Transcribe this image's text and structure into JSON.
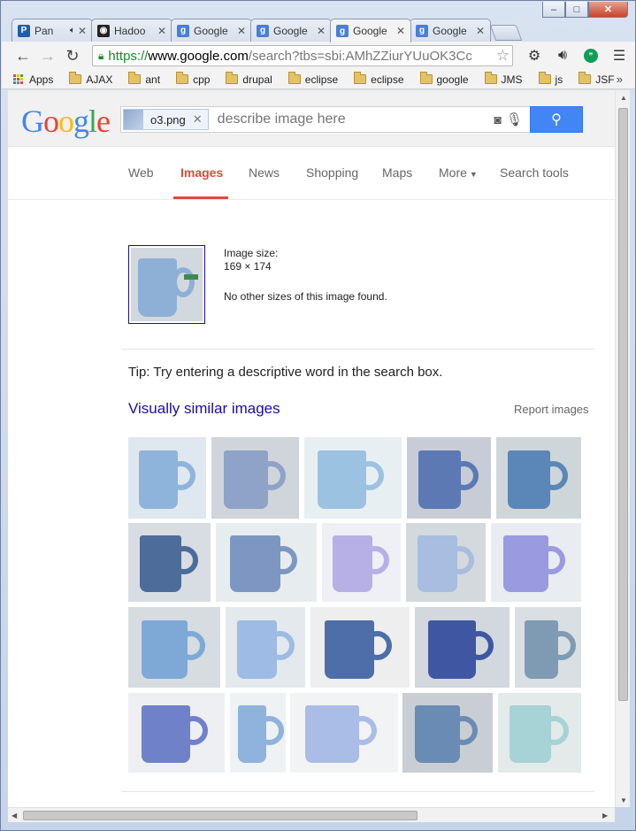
{
  "window_controls": {
    "minimize": "‒",
    "maximize": "□",
    "close": "✕"
  },
  "tabs": [
    {
      "title": "Pan",
      "favicon": "P",
      "favicon_color": "#1f5fa8",
      "active": false,
      "audio": true
    },
    {
      "title": "Hadoo",
      "favicon": "◉",
      "favicon_color": "#222222",
      "active": false,
      "audio": false
    },
    {
      "title": "Google",
      "favicon": "g",
      "favicon_color": "#4a7fd4",
      "active": false,
      "audio": false
    },
    {
      "title": "Google",
      "favicon": "g",
      "favicon_color": "#4a7fd4",
      "active": false,
      "audio": false
    },
    {
      "title": "Google",
      "favicon": "g",
      "favicon_color": "#4a7fd4",
      "active": true,
      "audio": false
    },
    {
      "title": "Google",
      "favicon": "g",
      "favicon_color": "#4a7fd4",
      "active": false,
      "audio": false
    }
  ],
  "toolbar": {
    "back": "←",
    "forward": "→",
    "reload": "↻",
    "url_scheme": "https://",
    "url_host": "www.google.com",
    "url_path": "/search?tbs=sbi:AMhZZiurYUuOK3Cc",
    "star": "☆",
    "extensions": [
      "gear-icon",
      "speaker-icon",
      "hangouts-icon",
      "menu-icon"
    ]
  },
  "bookmarks": {
    "apps_label": "Apps",
    "items": [
      "AJAX",
      "ant",
      "cpp",
      "drupal",
      "eclipse",
      "eclipse",
      "google",
      "JMS",
      "js",
      "JSF"
    ],
    "more": "»"
  },
  "google": {
    "logo_letters": [
      {
        "ch": "G",
        "color": "#4285f4"
      },
      {
        "ch": "o",
        "color": "#ea4335"
      },
      {
        "ch": "o",
        "color": "#fbbc05"
      },
      {
        "ch": "g",
        "color": "#4285f4"
      },
      {
        "ch": "l",
        "color": "#34a853"
      },
      {
        "ch": "e",
        "color": "#ea4335"
      }
    ],
    "chip_label": "o3.png",
    "chip_close": "✕",
    "search_placeholder": "describe image here",
    "camera": "📷",
    "mic": "🎤",
    "search_button": "🔍"
  },
  "nav_tabs": [
    {
      "label": "Web",
      "active": false
    },
    {
      "label": "Images",
      "active": true
    },
    {
      "label": "News",
      "active": false
    },
    {
      "label": "Shopping",
      "active": false
    },
    {
      "label": "Maps",
      "active": false
    },
    {
      "label": "More",
      "active": false,
      "dropdown": true
    },
    {
      "label": "Search tools",
      "active": false
    }
  ],
  "result": {
    "size_label": "Image size:",
    "size_value": "169 × 174",
    "no_other_sizes": "No other sizes of this image found."
  },
  "tip": "Tip: Try entering a descriptive word in the search box.",
  "similar": {
    "title": "Visually similar images",
    "report": "Report images",
    "rows": [
      [
        {
          "bg": "#dfe7ef",
          "mug": "#8fb4dc"
        },
        {
          "bg": "#cfd5da",
          "mug": "#8fa2c7"
        },
        {
          "bg": "#e8eff3",
          "mug": "#9cc2e2"
        },
        {
          "bg": "#c7ccd6",
          "mug": "#5d79b3"
        },
        {
          "bg": "#cfd6da",
          "mug": "#5a87b8"
        }
      ],
      [
        {
          "bg": "#d7dde2",
          "mug": "#4e6c9a"
        },
        {
          "bg": "#e7ecee",
          "mug": "#7d97c2"
        },
        {
          "bg": "#eef0f5",
          "mug": "#b6b0e6"
        },
        {
          "bg": "#d3d9dd",
          "mug": "#a8bddf"
        },
        {
          "bg": "#e9ecf0",
          "mug": "#9a9ae0"
        }
      ],
      [
        {
          "bg": "#d6dce0",
          "mug": "#7ea9d6"
        },
        {
          "bg": "#e4e9ed",
          "mug": "#9dbbe4"
        },
        {
          "bg": "#eeeeee",
          "mug": "#4d6ea8"
        },
        {
          "bg": "#d2d8de",
          "mug": "#3f56a3"
        },
        {
          "bg": "#d9dfe3",
          "mug": "#7f9bb3"
        }
      ],
      [
        {
          "bg": "#eeeff3",
          "mug": "#6f82c9"
        },
        {
          "bg": "#eef2f4",
          "mug": "#8fb3dc"
        },
        {
          "bg": "#f2f3f5",
          "mug": "#a9bde6"
        },
        {
          "bg": "#c9ced4",
          "mug": "#6a8cb4"
        },
        {
          "bg": "#e4e9ea",
          "mug": "#a7d2d6"
        }
      ]
    ]
  }
}
